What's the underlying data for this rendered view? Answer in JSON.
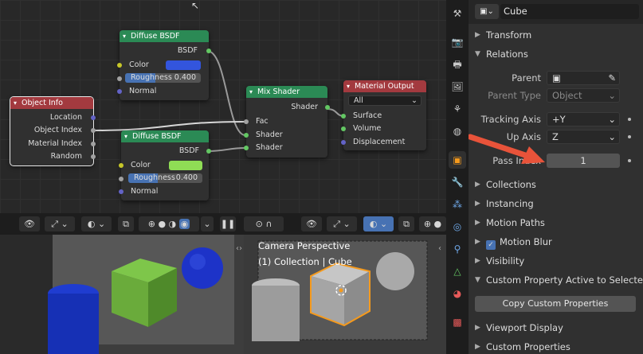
{
  "node_editor": {
    "diffuse1": {
      "title": "Diffuse BSDF",
      "output": "BSDF",
      "color_label": "Color",
      "color": "#3355dd",
      "roughness_label": "Roughness",
      "roughness_value": "0.400",
      "roughness_level": 0.4,
      "normal_label": "Normal"
    },
    "diffuse2": {
      "title": "Diffuse BSDF",
      "output": "BSDF",
      "color_label": "Color",
      "color": "#8fdd55",
      "roughness_label": "Roughness",
      "roughness_value": "0.400",
      "roughness_level": 0.4,
      "normal_label": "Normal"
    },
    "object_info": {
      "title": "Object Info",
      "outputs": [
        "Location",
        "Object Index",
        "Material Index",
        "Random"
      ]
    },
    "mix_shader": {
      "title": "Mix Shader",
      "output": "Shader",
      "inputs": [
        "Fac",
        "Shader",
        "Shader"
      ]
    },
    "material_output": {
      "title": "Material Output",
      "target": "All",
      "inputs": [
        "Surface",
        "Volume",
        "Displacement"
      ]
    }
  },
  "viewport": {
    "camera_label": "Camera Perspective",
    "collection_label": "(1) Collection | Cube",
    "header_icons": [
      "eye-icon",
      "transform-icon",
      "overlay-icon",
      "xray-icon",
      "shading-wireframe-icon",
      "shading-solid-icon",
      "shading-material-icon",
      "shading-rendered-icon",
      "pause-icon",
      "snap-icon",
      "falloff-icon"
    ]
  },
  "properties": {
    "object_name": "Cube",
    "sections": {
      "transform": "Transform",
      "relations": "Relations",
      "collections": "Collections",
      "instancing": "Instancing",
      "motion_paths": "Motion Paths",
      "motion_blur": "Motion Blur",
      "visibility": "Visibility",
      "custom_prop_active": "Custom Property Active to Selected",
      "viewport_display": "Viewport Display",
      "custom_properties": "Custom Properties"
    },
    "relations": {
      "parent_label": "Parent",
      "parent_type_label": "Parent Type",
      "parent_type_value": "Object",
      "tracking_axis_label": "Tracking Axis",
      "tracking_axis_value": "+Y",
      "up_axis_label": "Up Axis",
      "up_axis_value": "Z",
      "pass_index_label": "Pass Index",
      "pass_index_value": "1"
    },
    "copy_button": "Copy Custom Properties"
  },
  "colors": {
    "accent": "#4772b3",
    "arrow": "#e8533a",
    "node_green": "#2b8a55",
    "node_red": "#a33a3f",
    "selection": "#f59a1d"
  }
}
